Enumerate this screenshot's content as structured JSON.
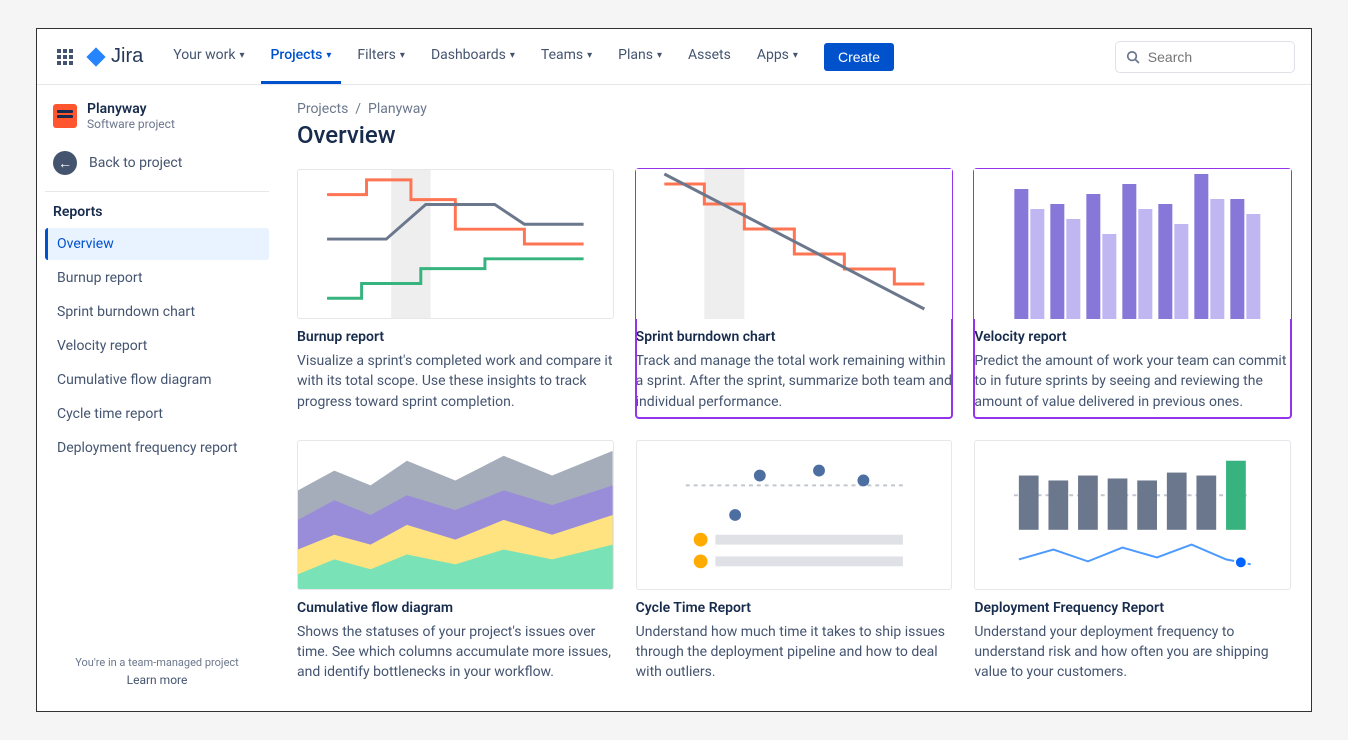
{
  "nav": {
    "items": [
      {
        "label": "Your work",
        "active": false,
        "caret": true
      },
      {
        "label": "Projects",
        "active": true,
        "caret": true
      },
      {
        "label": "Filters",
        "active": false,
        "caret": true
      },
      {
        "label": "Dashboards",
        "active": false,
        "caret": true
      },
      {
        "label": "Teams",
        "active": false,
        "caret": true
      },
      {
        "label": "Plans",
        "active": false,
        "caret": true
      },
      {
        "label": "Assets",
        "active": false,
        "caret": false
      },
      {
        "label": "Apps",
        "active": false,
        "caret": true
      }
    ],
    "create": "Create",
    "logo_text": "Jira",
    "search_placeholder": "Search"
  },
  "sidebar": {
    "project_name": "Planyway",
    "project_type": "Software project",
    "back_label": "Back to project",
    "section": "Reports",
    "items": [
      {
        "label": "Overview",
        "selected": true
      },
      {
        "label": "Burnup report",
        "selected": false
      },
      {
        "label": "Sprint burndown chart",
        "selected": false
      },
      {
        "label": "Velocity report",
        "selected": false
      },
      {
        "label": "Cumulative flow diagram",
        "selected": false
      },
      {
        "label": "Cycle time report",
        "selected": false
      },
      {
        "label": "Deployment frequency report",
        "selected": false
      }
    ],
    "footer_text": "You're in a team-managed project",
    "footer_link": "Learn more"
  },
  "main": {
    "breadcrumb_parent": "Projects",
    "breadcrumb_current": "Planyway",
    "title": "Overview",
    "cards": [
      {
        "title": "Burnup report",
        "desc": "Visualize a sprint's completed work and compare it with its total scope. Use these insights to track progress toward sprint completion.",
        "highlight": false
      },
      {
        "title": "Sprint burndown chart",
        "desc": "Track and manage the total work remaining within a sprint. After the sprint, summarize both team and individual performance.",
        "highlight": true
      },
      {
        "title": "Velocity report",
        "desc": "Predict the amount of work your team can commit to in future sprints by seeing and reviewing the amount of value delivered in previous ones.",
        "highlight": true
      },
      {
        "title": "Cumulative flow diagram",
        "desc": "Shows the statuses of your project's issues over time. See which columns accumulate more issues, and identify bottlenecks in your workflow.",
        "highlight": false
      },
      {
        "title": "Cycle Time Report",
        "desc": "Understand how much time it takes to ship issues through the deployment pipeline and how to deal with outliers.",
        "highlight": false
      },
      {
        "title": "Deployment Frequency Report",
        "desc": "Understand your deployment frequency to understand risk and how often you are shipping value to your customers.",
        "highlight": false
      }
    ]
  }
}
